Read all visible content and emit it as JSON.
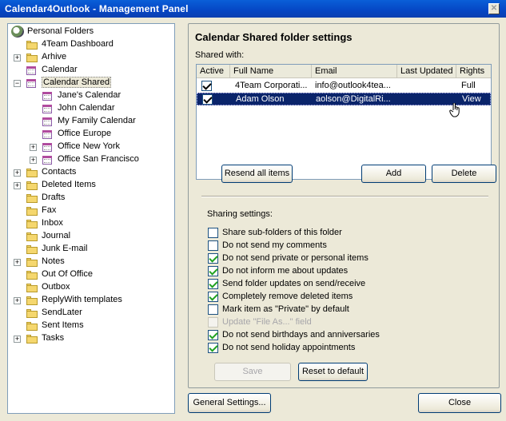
{
  "window": {
    "title": "Calendar4Outlook - Management Panel",
    "close_glyph": "✕"
  },
  "tree": {
    "root": {
      "label": "Personal Folders",
      "icon": "personal-folders-icon"
    },
    "items": [
      {
        "label": "4Team Dashboard",
        "level": 1,
        "expander": "",
        "icon": "folder-icon"
      },
      {
        "label": "Arhive",
        "level": 1,
        "expander": "+",
        "icon": "folder-icon"
      },
      {
        "label": "Calendar",
        "level": 1,
        "expander": "",
        "icon": "calendar-icon"
      },
      {
        "label": "Calendar Shared",
        "level": 1,
        "expander": "−",
        "icon": "calendar-icon",
        "selected": true
      },
      {
        "label": "Jane's Calendar",
        "level": 2,
        "expander": "",
        "icon": "calendar-icon"
      },
      {
        "label": "John Calendar",
        "level": 2,
        "expander": "",
        "icon": "calendar-icon"
      },
      {
        "label": "My Family Calendar",
        "level": 2,
        "expander": "",
        "icon": "calendar-icon"
      },
      {
        "label": "Office Europe",
        "level": 2,
        "expander": "",
        "icon": "calendar-icon"
      },
      {
        "label": "Office New York",
        "level": 2,
        "expander": "+",
        "icon": "calendar-icon"
      },
      {
        "label": "Office San Francisco",
        "level": 2,
        "expander": "+",
        "icon": "calendar-icon"
      },
      {
        "label": "Contacts",
        "level": 1,
        "expander": "+",
        "icon": "contacts-icon"
      },
      {
        "label": "Deleted Items",
        "level": 1,
        "expander": "+",
        "icon": "deleted-items-icon"
      },
      {
        "label": "Drafts",
        "level": 1,
        "expander": "",
        "icon": "folder-icon"
      },
      {
        "label": "Fax",
        "level": 1,
        "expander": "",
        "icon": "folder-icon"
      },
      {
        "label": "Inbox",
        "level": 1,
        "expander": "",
        "icon": "folder-icon"
      },
      {
        "label": "Journal",
        "level": 1,
        "expander": "",
        "icon": "journal-icon"
      },
      {
        "label": "Junk E-mail",
        "level": 1,
        "expander": "",
        "icon": "folder-icon"
      },
      {
        "label": "Notes",
        "level": 1,
        "expander": "+",
        "icon": "notes-icon"
      },
      {
        "label": "Out Of Office",
        "level": 1,
        "expander": "",
        "icon": "folder-icon"
      },
      {
        "label": "Outbox",
        "level": 1,
        "expander": "",
        "icon": "folder-icon"
      },
      {
        "label": "ReplyWith templates",
        "level": 1,
        "expander": "+",
        "icon": "folder-icon"
      },
      {
        "label": "SendLater",
        "level": 1,
        "expander": "",
        "icon": "folder-icon"
      },
      {
        "label": "Sent Items",
        "level": 1,
        "expander": "",
        "icon": "folder-icon"
      },
      {
        "label": "Tasks",
        "level": 1,
        "expander": "+",
        "icon": "tasks-icon"
      }
    ]
  },
  "settings": {
    "title": "Calendar Shared folder settings",
    "shared_with_label": "Shared with:",
    "columns": [
      "Active",
      "Full Name",
      "Email",
      "Last Updated",
      "Rights"
    ],
    "rows": [
      {
        "active": true,
        "full_name": "4Team Corporati...",
        "email": "info@outlook4tea...",
        "last_updated": "",
        "rights": "Full",
        "selected": false
      },
      {
        "active": true,
        "full_name": "Adam Olson",
        "email": "aolson@DigitalRi...",
        "last_updated": "",
        "rights": "View",
        "selected": true
      }
    ],
    "resend_label": "Resend all items",
    "add_label": "Add",
    "delete_label": "Delete",
    "sharing_settings_label": "Sharing settings:",
    "options": [
      {
        "label": "Share sub-folders of this folder",
        "checked": false,
        "enabled": true
      },
      {
        "label": "Do not send my comments",
        "checked": false,
        "enabled": true
      },
      {
        "label": "Do not send private or personal items",
        "checked": true,
        "enabled": true
      },
      {
        "label": "Do not inform me about updates",
        "checked": true,
        "enabled": true
      },
      {
        "label": "Send folder updates on send/receive",
        "checked": true,
        "enabled": true
      },
      {
        "label": "Completely remove deleted items",
        "checked": true,
        "enabled": true
      },
      {
        "label": "Mark item as \"Private\" by default",
        "checked": false,
        "enabled": true
      },
      {
        "label": "Update \"File As...\" field",
        "checked": false,
        "enabled": false
      },
      {
        "label": "Do not send birthdays and anniversaries",
        "checked": true,
        "enabled": true
      },
      {
        "label": "Do not send holiday appointments",
        "checked": true,
        "enabled": true
      }
    ],
    "save_label": "Save",
    "reset_label": "Reset to default"
  },
  "footer": {
    "general_settings_label": "General Settings...",
    "close_label": "Close"
  }
}
